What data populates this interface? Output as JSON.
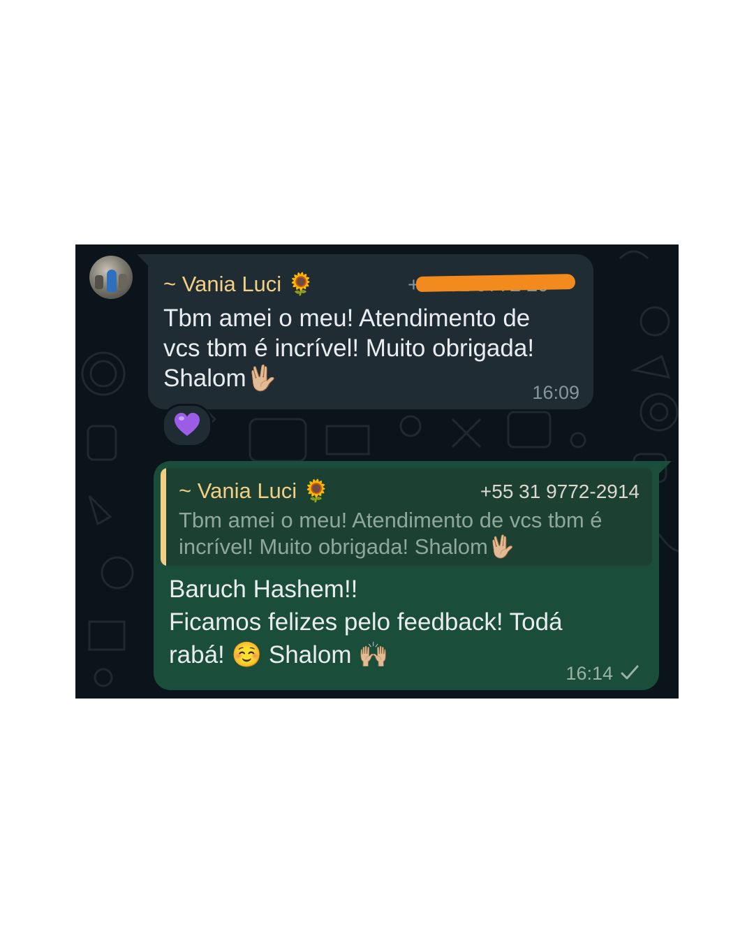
{
  "incoming": {
    "sender": "~ Vania Luci",
    "sender_emoji": "🌻",
    "phone_visible": "+55 31 9772 29",
    "text_line1": "Tbm amei o meu! Atendimento de",
    "text_line2": "vcs tbm é incrível!  Muito obrigada!",
    "text_line3": "Shalom",
    "text_line3_emoji": "🖖🏼",
    "time": "16:09",
    "reaction_icon": "purple-heart-icon",
    "reaction_color": "#9b5de5"
  },
  "outgoing": {
    "quote": {
      "sender": "~ Vania Luci",
      "sender_emoji": "🌻",
      "phone": "+55 31 9772-2914",
      "text_line1": "Tbm amei o meu! Atendimento de vcs tbm é",
      "text_line2": "incrível!  Muito obrigada! Shalom",
      "text_line2_emoji": "🖖🏼"
    },
    "text_line1": "Baruch Hashem!!",
    "text_line2": "Ficamos felizes pelo feedback! Todá",
    "text_line3_a": "rabá!",
    "text_line3_emoji1": "☺️",
    "text_line3_b": "Shalom",
    "text_line3_emoji2": "🙌🏼",
    "time": "16:14",
    "status_icon": "single-check-icon"
  },
  "colors": {
    "chat_background": "#0b141a",
    "incoming_bubble": "#202c33",
    "outgoing_bubble": "#1a4d3a",
    "sender_name": "#f3cf84",
    "redaction": "#f28a1e"
  }
}
